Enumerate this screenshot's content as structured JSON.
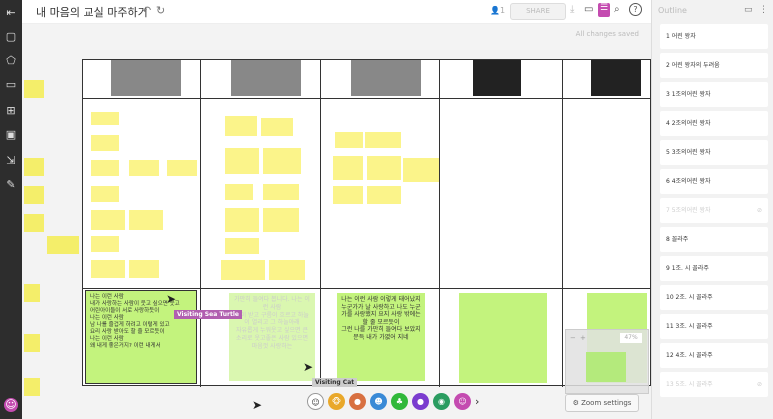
{
  "app": {
    "title": "내 마음의 교실 마주하기",
    "share_label": "SHARE",
    "user_count": "1",
    "saved_status": "All changes saved",
    "zoom_label": "Zoom settings",
    "zoom_percent": "47%"
  },
  "outline": {
    "title": "Outline",
    "items": [
      {
        "label": "1 어린 왕자"
      },
      {
        "label": "2 어린 왕자의 두려움"
      },
      {
        "label": "3 1조의어린 왕자"
      },
      {
        "label": "4 2조의어린 왕자"
      },
      {
        "label": "5 3조의어린 왕자"
      },
      {
        "label": "6 4조의어린 왕자"
      },
      {
        "label": "7 5조의어린 왕자"
      },
      {
        "label": "8 꼴라주"
      },
      {
        "label": "9 1조. 시 꼴라주"
      },
      {
        "label": "10 2조. 시 꼴라주"
      },
      {
        "label": "11 3조. 시 꼴라주"
      },
      {
        "label": "12 4조. 시 꼴라주"
      },
      {
        "label": "13 5조. 시 꼴라주"
      }
    ]
  },
  "cards": {
    "g1": "나는 이런 사람\n내가 사랑하는 사람이 웃고 싶으면 웃고\n어린아이들이 서로 사랑하듯이\n나는 이런 사람\n남 나를 즐겁게 하려고 이렇게 있고\n요리 사랑 받아도 할 줄 모르듯이\n나는 이런 사람\n왜 내게 좋은거지? 이런 내게서",
    "g2": "가만히 들여다 봅니다. 나는 이런 사람\n살이 받고 구름이 흐르고 하늘이 열리고 그 하늘아래\n자유롭게 누워웃고 싶으면 큰 소리로 웃고좋은 사람 있으면 마음껏 사랑하는",
    "g3": "나는 이런 사람 이렇게 태어났지\n누군가가 날 사랑하고 나도 누군가를 사랑했지 요지 사랑 밖에는 할 줄 모르듯이\n그런 나를 가만히 들여다 보았지 문득 내가 가엾어 지네"
  },
  "cursors": {
    "c1": "Visiting Sea Turtle",
    "c2": "Visiting Cat"
  },
  "colors": {
    "accent": "#b15fb0",
    "sticky": "#fbf48a",
    "card": "#c3f37d"
  }
}
